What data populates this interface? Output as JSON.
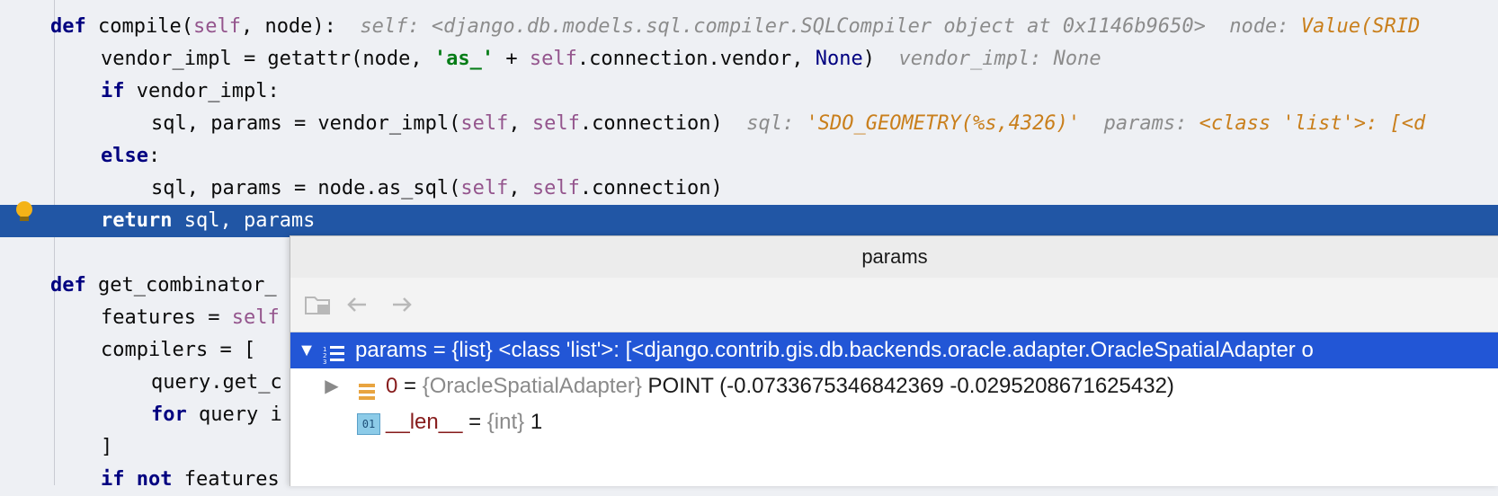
{
  "code_lines": [
    {
      "id": "l1",
      "segments": [
        [
          "kw",
          "def"
        ],
        [
          "t",
          " compile("
        ],
        [
          "self",
          "self"
        ],
        [
          "t",
          ", node):  "
        ],
        [
          "hint",
          "self: <django.db.models.sql.compiler.SQLCompiler object at 0x1146b9650>  node: "
        ],
        [
          "hintv",
          "Value(SRID"
        ]
      ]
    },
    {
      "id": "l2",
      "segments": [
        [
          "t",
          "vendor_impl = getattr(node, "
        ],
        [
          "str",
          "'as_'"
        ],
        [
          "t",
          " + "
        ],
        [
          "self",
          "self"
        ],
        [
          "t",
          ".connection.vendor, "
        ],
        [
          "none",
          "None"
        ],
        [
          "t",
          ")  "
        ],
        [
          "hint",
          "vendor_impl: None"
        ]
      ]
    },
    {
      "id": "l3",
      "segments": [
        [
          "kw",
          "if"
        ],
        [
          "t",
          " vendor_impl:"
        ]
      ]
    },
    {
      "id": "l4",
      "segments": [
        [
          "t",
          "sql, params = vendor_impl("
        ],
        [
          "self",
          "self"
        ],
        [
          "t",
          ", "
        ],
        [
          "self",
          "self"
        ],
        [
          "t",
          ".connection)  "
        ],
        [
          "hint",
          "sql: "
        ],
        [
          "hintv",
          "'SDO_GEOMETRY(%s,4326)'"
        ],
        [
          "hint",
          "  params: "
        ],
        [
          "hintv",
          "<class 'list'>: [<d"
        ]
      ]
    },
    {
      "id": "l5",
      "segments": [
        [
          "kw",
          "else"
        ],
        [
          "t",
          ":"
        ]
      ]
    },
    {
      "id": "l6",
      "segments": [
        [
          "t",
          "sql, params = node.as_sql("
        ],
        [
          "self",
          "self"
        ],
        [
          "t",
          ", "
        ],
        [
          "self",
          "self"
        ],
        [
          "t",
          ".connection)"
        ]
      ]
    },
    {
      "id": "l7",
      "segments": [
        [
          "kw",
          "return"
        ],
        [
          "t",
          " sql, params"
        ]
      ]
    },
    {
      "id": "l8",
      "segments": []
    },
    {
      "id": "l9",
      "segments": [
        [
          "kw",
          "def"
        ],
        [
          "t",
          " get_combinator_"
        ]
      ]
    },
    {
      "id": "l10",
      "segments": [
        [
          "t",
          "features = "
        ],
        [
          "self",
          "self"
        ]
      ]
    },
    {
      "id": "l11",
      "segments": [
        [
          "t",
          "compilers = ["
        ]
      ]
    },
    {
      "id": "l12",
      "segments": [
        [
          "t",
          "query.get_c"
        ]
      ]
    },
    {
      "id": "l13",
      "segments": [
        [
          "kw",
          "for"
        ],
        [
          "t",
          " query i"
        ]
      ]
    },
    {
      "id": "l14",
      "segments": [
        [
          "t",
          "]"
        ]
      ]
    },
    {
      "id": "l15",
      "segments": [
        [
          "kw",
          "if not"
        ],
        [
          "t",
          " features"
        ]
      ]
    }
  ],
  "popup": {
    "title": "params",
    "toolbar": {
      "folder_icon": "folder-icon",
      "back_icon": "back-arrow-icon",
      "forward_icon": "forward-arrow-icon"
    },
    "rows": [
      {
        "expanded": true,
        "icon": "list-icon",
        "name": "params",
        "eq": " = ",
        "type": "{list} <class 'list'>: ",
        "value": "[<django.contrib.gis.db.backends.oracle.adapter.OracleSpatialAdapter o"
      },
      {
        "expanded": false,
        "icon": "object-icon",
        "name": "0",
        "eq": " = ",
        "type": "{OracleSpatialAdapter} ",
        "value": "POINT (-0.0733675346842369 -0.0295208671625432)"
      },
      {
        "expanded": null,
        "icon": "int-icon",
        "name": "__len__",
        "eq": " = ",
        "type": "{int} ",
        "value": "1"
      }
    ],
    "int_icon_label": "01"
  },
  "colors": {
    "execution_line": "#2156a5",
    "selected_row": "#2256d6",
    "breakpoint_bulb": "#f4b318"
  }
}
